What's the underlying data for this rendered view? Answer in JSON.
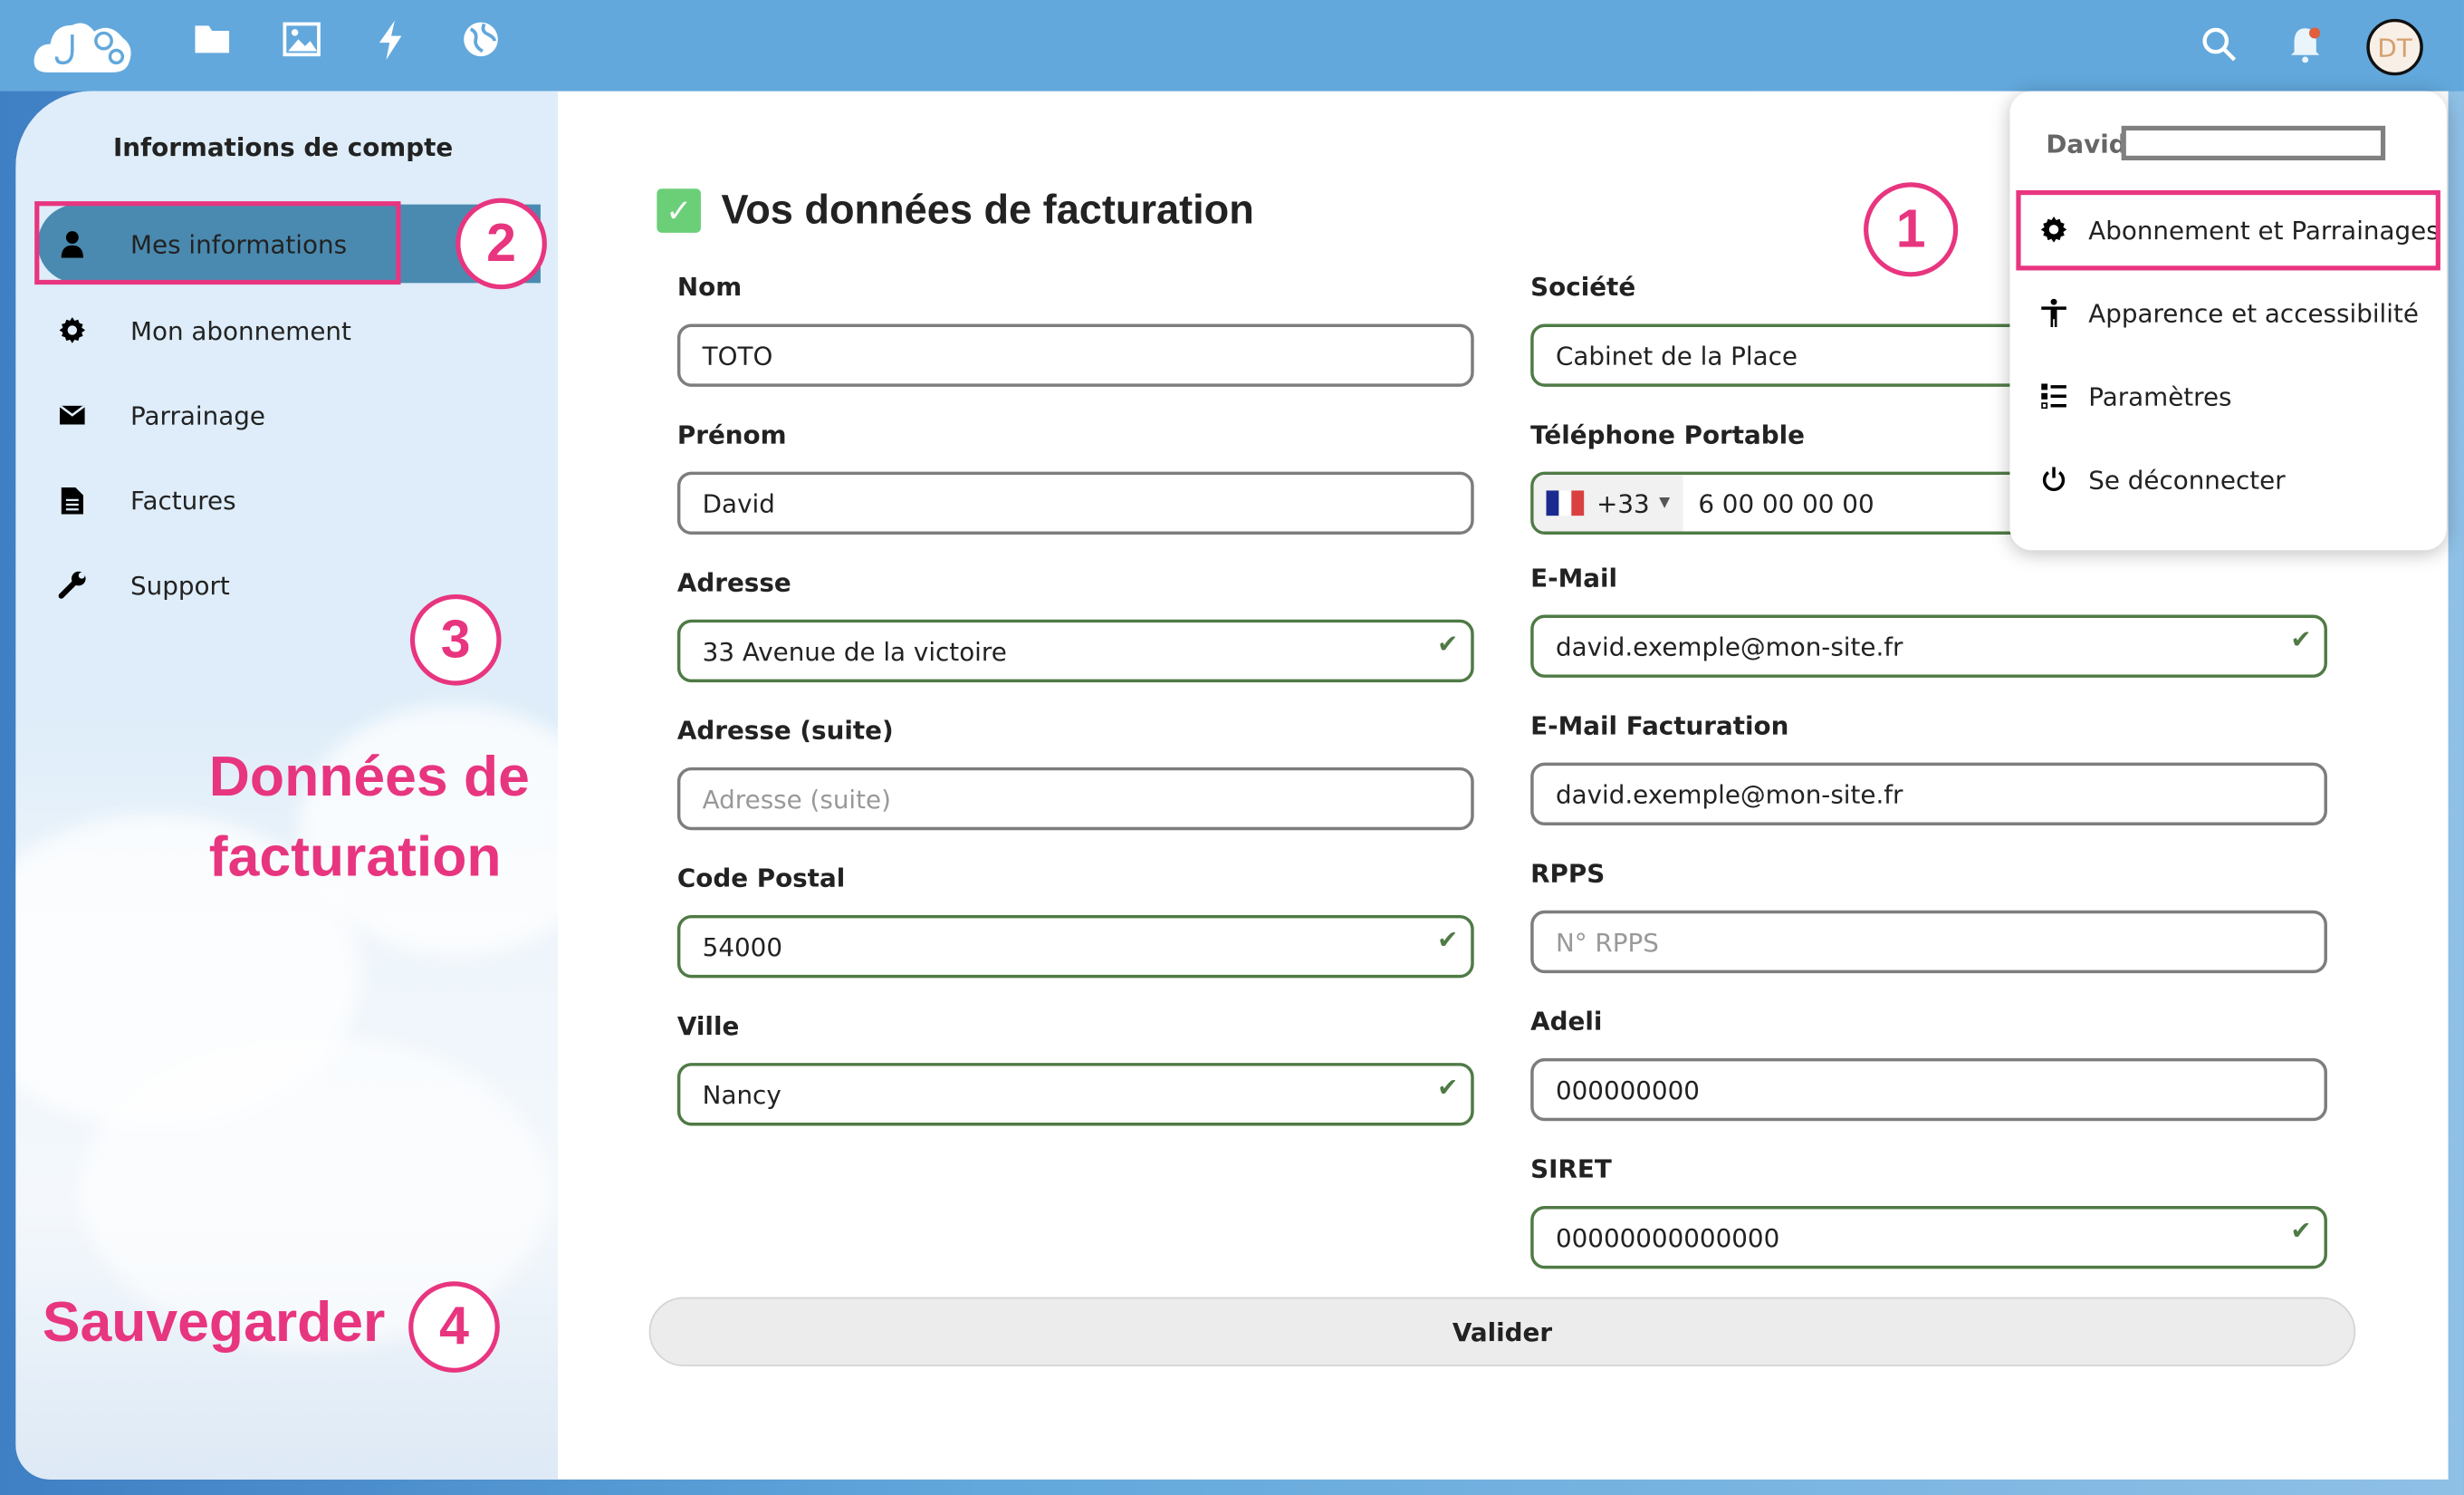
{
  "topbar": {
    "nav_icons": [
      "folder-icon",
      "image-icon",
      "flash-icon",
      "globe-icon"
    ],
    "avatar_initials": "DT",
    "brand_color": "#62a8dc"
  },
  "sidebar": {
    "title": "Informations de compte",
    "items": [
      {
        "label": "Mes informations",
        "icon": "user-icon",
        "active": true
      },
      {
        "label": "Mon abonnement",
        "icon": "gear-icon"
      },
      {
        "label": "Parrainage",
        "icon": "envelope-icon"
      },
      {
        "label": "Factures",
        "icon": "document-icon"
      },
      {
        "label": "Support",
        "icon": "wrench-icon"
      }
    ]
  },
  "annotations": {
    "n1": "1",
    "n2": "2",
    "n3": "3",
    "n4": "4",
    "donnees": "Données de facturation",
    "sauvegarder": "Sauvegarder",
    "color": "#e8357f"
  },
  "form": {
    "title": "Vos données de facturation",
    "left": [
      {
        "label": "Nom",
        "value": "TOTO"
      },
      {
        "label": "Prénom",
        "value": "David"
      },
      {
        "label": "Adresse",
        "value": "33 Avenue de la victoire",
        "valid": true
      },
      {
        "label": "Adresse (suite)",
        "placeholder": "Adresse (suite)"
      },
      {
        "label": "Code Postal",
        "value": "54000",
        "valid": true
      },
      {
        "label": "Ville",
        "value": "Nancy",
        "valid": true
      }
    ],
    "right": [
      {
        "label": "Société",
        "value": "Cabinet de la Place"
      },
      {
        "label": "Téléphone Portable",
        "country_code": "+33",
        "value": "6 00 00 00 00"
      },
      {
        "label": "E-Mail",
        "value": "david.exemple@mon-site.fr",
        "valid": true
      },
      {
        "label": "E-Mail Facturation",
        "value": "david.exemple@mon-site.fr"
      },
      {
        "label": "RPPS",
        "placeholder": "N° RPPS"
      },
      {
        "label": "Adeli",
        "value": "000000000"
      },
      {
        "label": "SIRET",
        "value": "00000000000000",
        "valid": true
      }
    ],
    "submit": "Valider"
  },
  "user_menu": {
    "name": "David",
    "items": [
      {
        "label": "Abonnement et Parrainages",
        "icon": "gear-icon"
      },
      {
        "label": "Apparence et accessibilité",
        "icon": "accessibility-icon"
      },
      {
        "label": "Paramètres",
        "icon": "list-icon"
      },
      {
        "label": "Se déconnecter",
        "icon": "power-icon"
      }
    ]
  }
}
